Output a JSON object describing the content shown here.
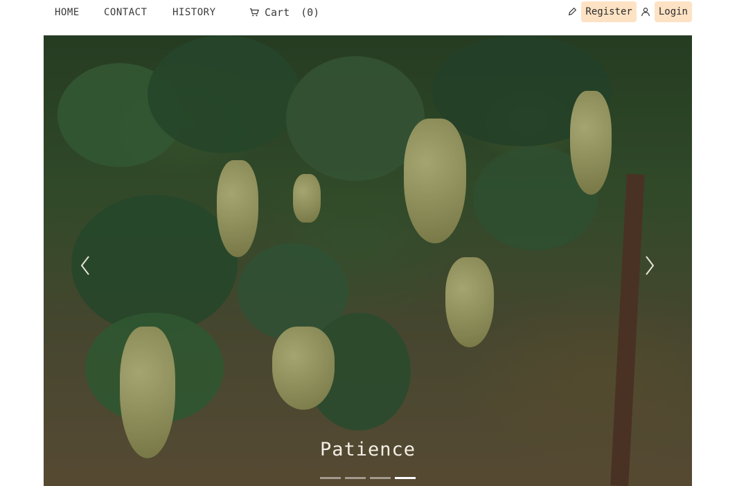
{
  "nav": {
    "home": "HOME",
    "contact": "CONTACT",
    "history": "HISTORY",
    "cart_label": "Cart",
    "cart_count": "(0)"
  },
  "auth": {
    "register": "Register",
    "login": "Login"
  },
  "hero": {
    "caption": "Patience",
    "slide_count": 4,
    "active_slide": 4
  },
  "icons": {
    "cart": "cart-icon",
    "register": "pencil-icon",
    "login": "user-icon",
    "prev": "chevron-left-icon",
    "next": "chevron-right-icon"
  },
  "colors": {
    "auth_button_bg": "#fde2c4",
    "caption_text": "#f4efe6"
  }
}
